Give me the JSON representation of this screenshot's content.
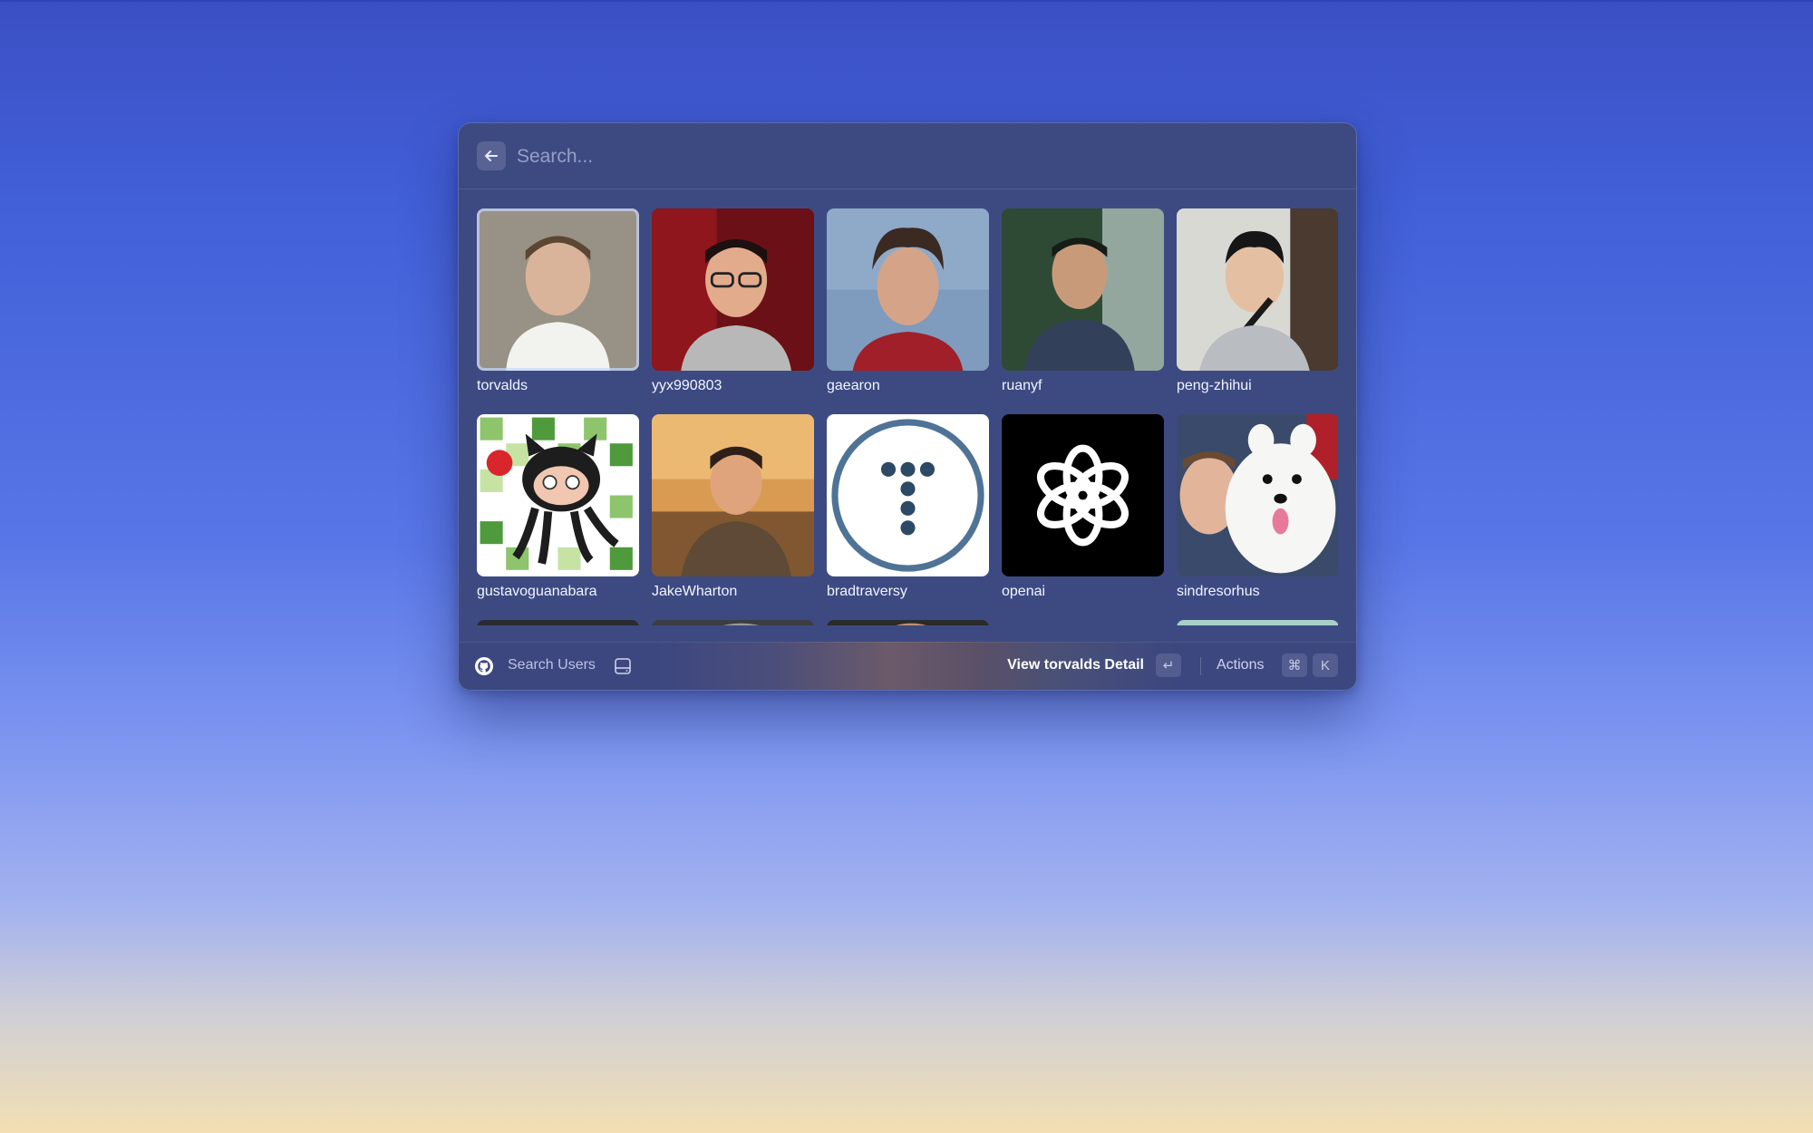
{
  "search": {
    "placeholder": "Search..."
  },
  "users": [
    {
      "name": "torvalds",
      "avatar": "photo-portrait",
      "selected": true
    },
    {
      "name": "yyx990803",
      "avatar": "photo-portrait"
    },
    {
      "name": "gaearon",
      "avatar": "photo-portrait"
    },
    {
      "name": "ruanyf",
      "avatar": "photo-portrait"
    },
    {
      "name": "peng-zhihui",
      "avatar": "photo-portrait"
    },
    {
      "name": "gustavoguanabara",
      "avatar": "octocat-illustration"
    },
    {
      "name": "JakeWharton",
      "avatar": "photo-portrait"
    },
    {
      "name": "bradtraversy",
      "avatar": "traversy-logo"
    },
    {
      "name": "openai",
      "avatar": "openai-logo"
    },
    {
      "name": "sindresorhus",
      "avatar": "photo-with-dog"
    },
    {
      "name": "",
      "avatar": "photo-portrait"
    },
    {
      "name": "",
      "avatar": "photo-portrait"
    },
    {
      "name": "",
      "avatar": "photo-portrait"
    },
    {
      "name": "",
      "avatar": "color-blocks"
    },
    {
      "name": "",
      "avatar": "photo-portrait"
    }
  ],
  "footer": {
    "app_icon": "github-icon",
    "command_name": "Search Users",
    "primary_action": "View torvalds Detail",
    "primary_key": "↵",
    "actions_label": "Actions",
    "actions_keys": [
      "⌘",
      "K"
    ]
  },
  "colors": {
    "window_bg": "#3d4a82",
    "text": "#f2f4ff"
  }
}
